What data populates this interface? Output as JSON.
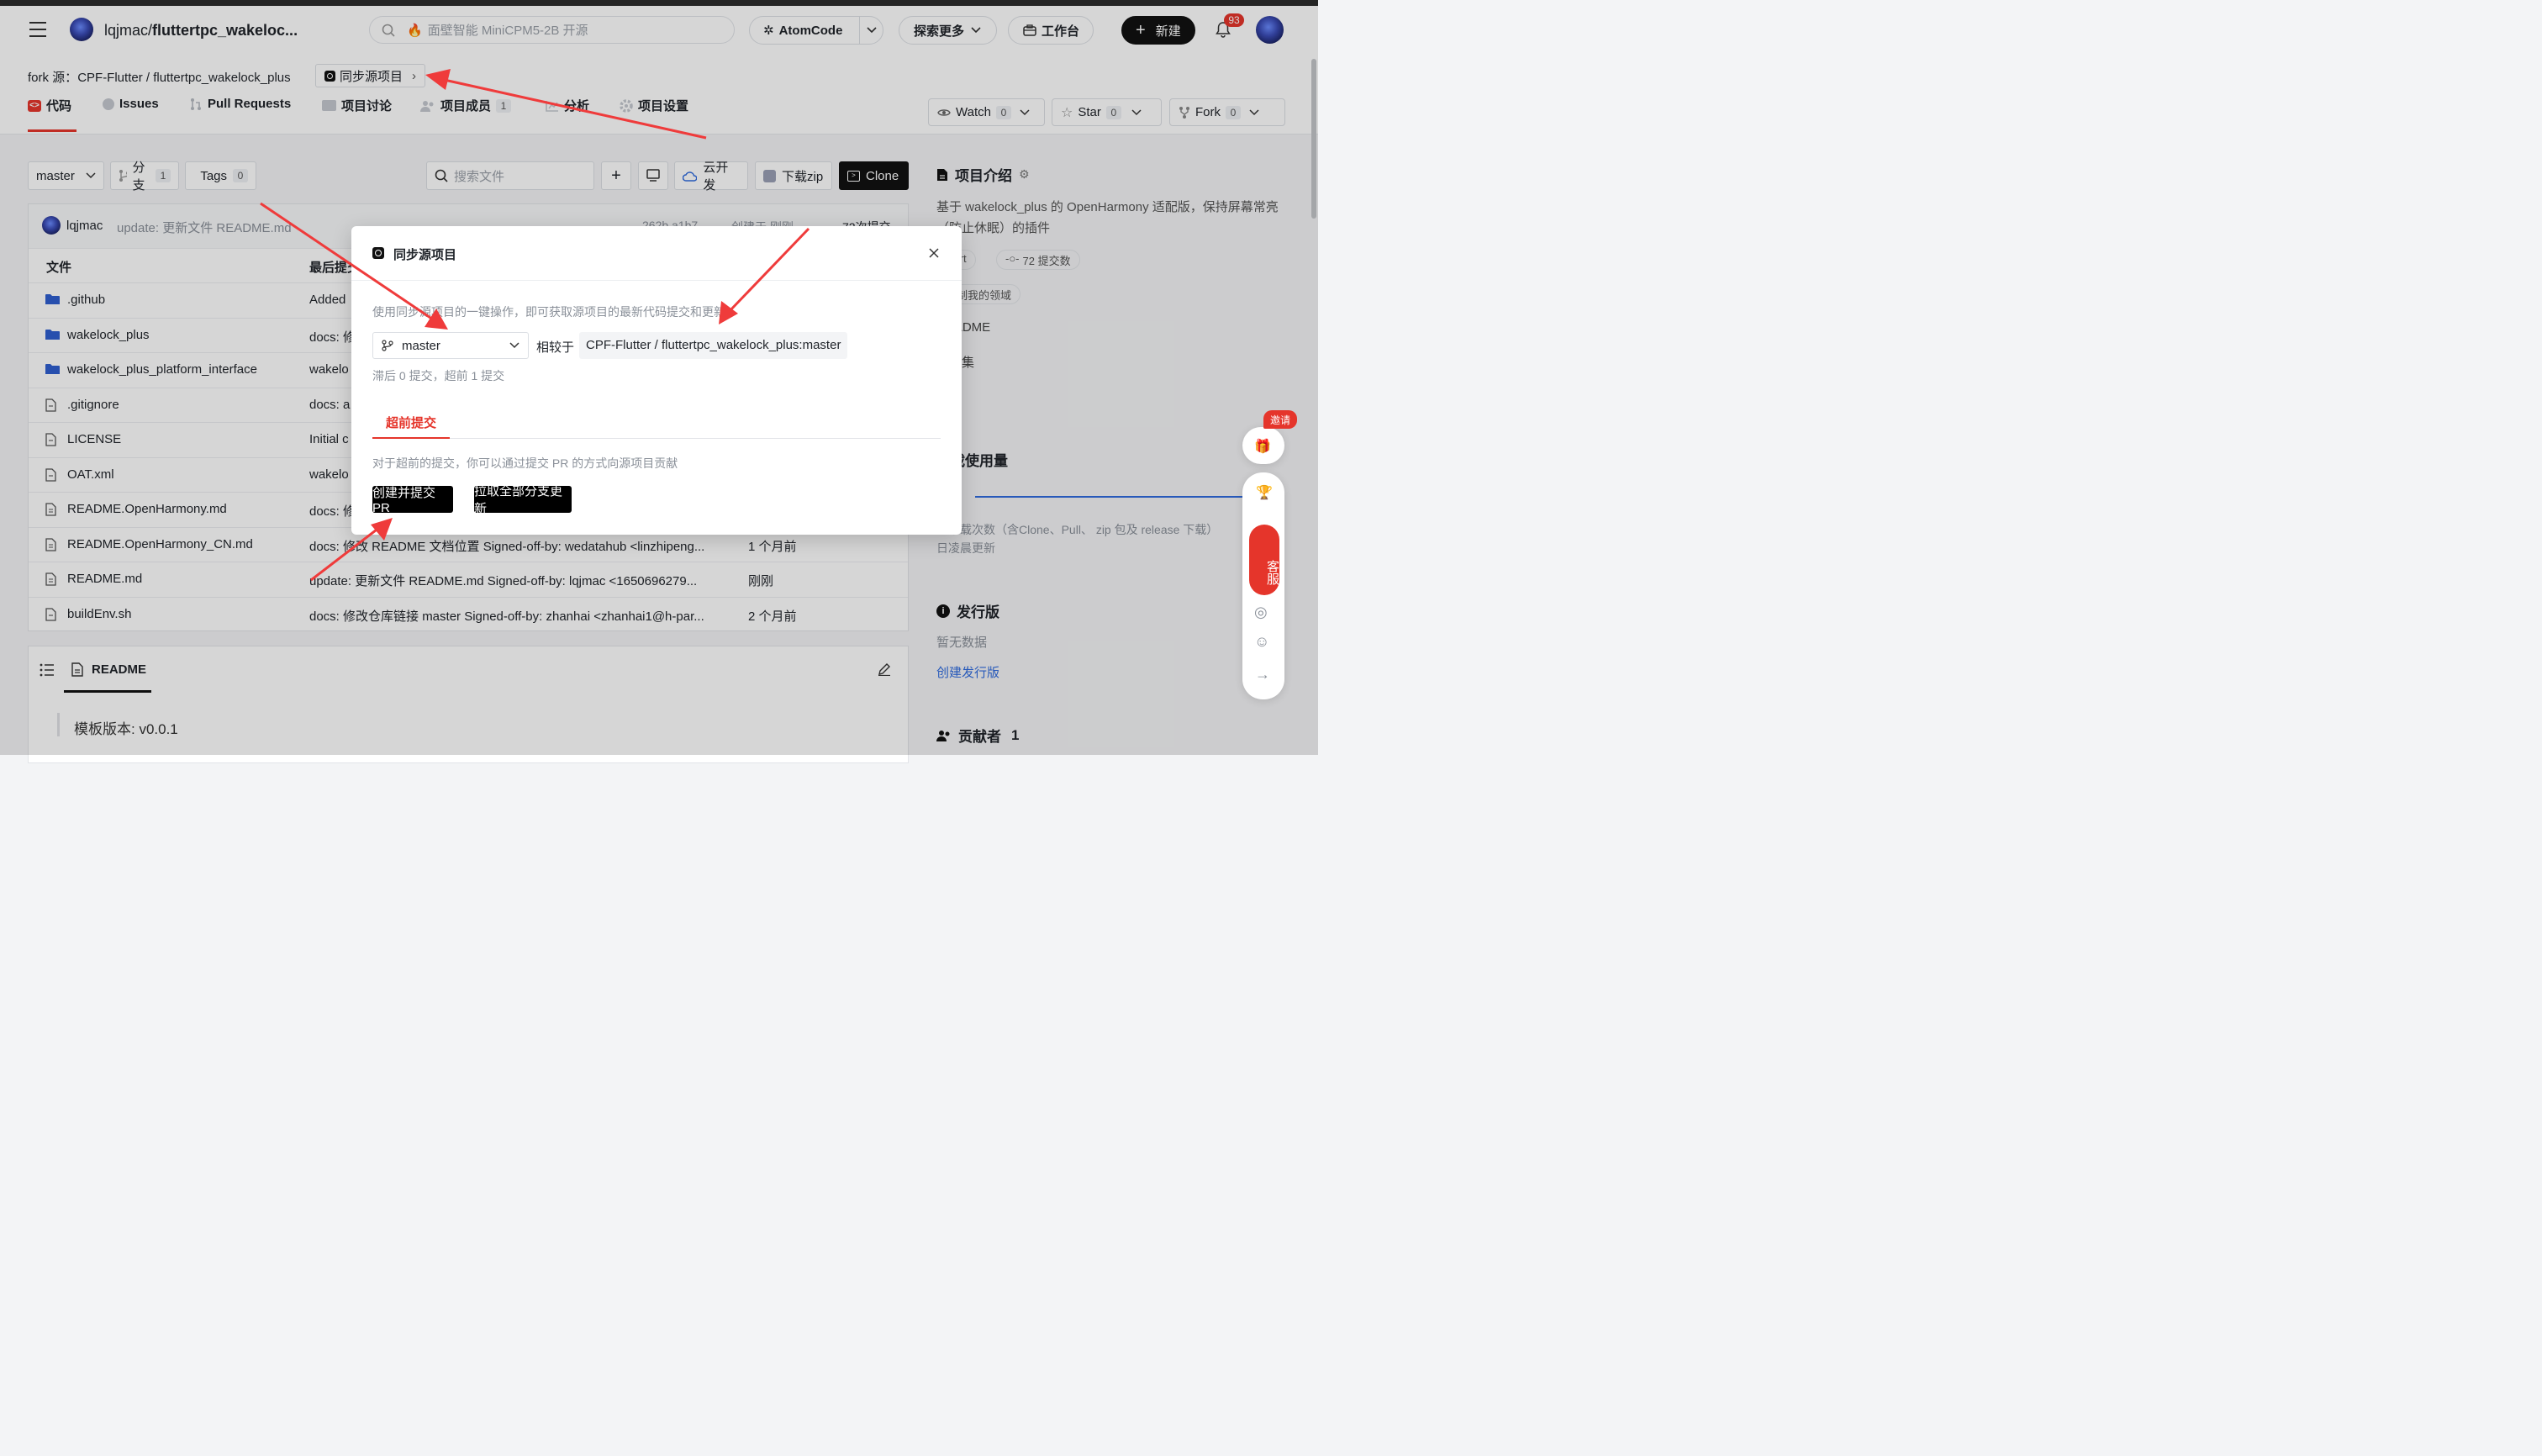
{
  "header": {
    "repo_path": "lqjmac/fluttertpc_wakeloc...",
    "repo_owner": "lqjmac/",
    "repo_name": "fluttertpc_wakeloc...",
    "search_placeholder": "面壁智能 MiniCPM5-2B 开源",
    "atomcode_label": "AtomCode",
    "explore_label": "探索更多",
    "workbench_label": "工作台",
    "new_label": "新建",
    "notification_count": "93"
  },
  "fork": {
    "prefix": "fork 源：",
    "source": "CPF-Flutter / fluttertpc_wakelock_plus",
    "sync_label": "同步源项目"
  },
  "tabs": [
    {
      "label": "代码"
    },
    {
      "label": "Issues"
    },
    {
      "label": "Pull Requests"
    },
    {
      "label": "项目讨论"
    },
    {
      "label": "项目成员",
      "count": "1"
    },
    {
      "label": "分析"
    },
    {
      "label": "项目设置"
    }
  ],
  "actions": {
    "watch_label": "Watch",
    "watch_count": "0",
    "star_label": "Star",
    "star_count": "0",
    "fork_label": "Fork",
    "fork_count": "0"
  },
  "toolbar": {
    "branch": "master",
    "branches_label": "分支",
    "branches_count": "1",
    "tags_label": "Tags",
    "tags_count": "0",
    "file_search_placeholder": "搜索文件",
    "cloud_dev_label": "云开发",
    "download_zip_label": "下载zip",
    "clone_label": "Clone"
  },
  "commit": {
    "author": "lqjmac",
    "message": "update: 更新文件 README.md",
    "hash": "262b a1b7",
    "created": "创建于 刚刚",
    "commits": "72次提交"
  },
  "files": {
    "col_file": "文件",
    "col_last_commit": "最后提交",
    "rows": [
      {
        "name": ".github",
        "type": "folder",
        "msg": "Added",
        "time": ""
      },
      {
        "name": "wakelock_plus",
        "type": "folder",
        "msg": "docs: 修",
        "time": ""
      },
      {
        "name": "wakelock_plus_platform_interface",
        "type": "folder",
        "msg": "wakelo",
        "time": ""
      },
      {
        "name": ".gitignore",
        "type": "file",
        "msg": "docs: a",
        "time": ""
      },
      {
        "name": "LICENSE",
        "type": "file",
        "msg": "Initial c",
        "time": ""
      },
      {
        "name": "OAT.xml",
        "type": "file",
        "msg": "wakelo",
        "time": ""
      },
      {
        "name": "README.OpenHarmony.md",
        "type": "doc",
        "msg": "docs: 修",
        "time": ""
      },
      {
        "name": "README.OpenHarmony_CN.md",
        "type": "doc",
        "msg": "docs: 修改 README 文档位置 Signed-off-by: wedatahub <linzhipeng...",
        "time": "1 个月前"
      },
      {
        "name": "README.md",
        "type": "doc",
        "msg": "update: 更新文件 README.md Signed-off-by: lqjmac <1650696279...",
        "time": "刚刚"
      },
      {
        "name": "buildEnv.sh",
        "type": "file",
        "msg": "docs: 修改仓库链接 master Signed-off-by: zhanhai <zhanhai1@h-par...",
        "time": "2 个月前"
      }
    ]
  },
  "readme": {
    "title": "README",
    "version_line": "模板版本: v0.0.1"
  },
  "sidebar": {
    "intro_title": "项目介绍",
    "intro_text_1": "基于 wakelock_plus 的 OpenHarmony 适配版，保持屏幕常亮",
    "intro_text_2": "（防止休眠）的插件",
    "lang_tag": "Dart",
    "commits_tag": "72 提交数",
    "domain_tag": "定制我的领域",
    "readme_link": "README",
    "rules_link": "规则集",
    "project_link": "项目",
    "downloads_title": "下载使用量",
    "downloads_note_1": "总下载次数（含Clone、Pull、 zip 包及 release 下载）",
    "downloads_note_2": "日凌晨更新",
    "release_title": "发行版",
    "release_empty": "暂无数据",
    "release_create": "创建发行版",
    "contrib_title": "贡献者",
    "contrib_count": "1"
  },
  "modal": {
    "title": "同步源项目",
    "desc": "使用同步源项目的一键操作，即可获取源项目的最新代码提交和更新",
    "branch": "master",
    "compare_label": "相较于",
    "compare_target": "CPF-Flutter / fluttertpc_wakelock_plus:master",
    "status": "滞后 0 提交，超前 1 提交",
    "tab_ahead": "超前提交",
    "ahead_note": "对于超前的提交，你可以通过提交 PR 的方式向源项目贡献",
    "create_pr_label": "创建并提交 PR",
    "pull_all_label": "拉取全部分支更新"
  },
  "float": {
    "invite_label": "邀请",
    "service_label": "客服"
  },
  "colors": {
    "accent_red": "#e5352b",
    "link_blue": "#2f6bde",
    "arrow_red": "#ef3b3b"
  }
}
